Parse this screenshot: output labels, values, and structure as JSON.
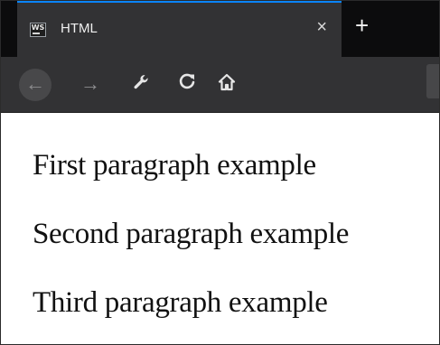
{
  "browser": {
    "tab": {
      "icon_text": "WS",
      "title": "HTML",
      "close_glyph": "×"
    },
    "new_tab_glyph": "+",
    "nav": {
      "back_glyph": "←",
      "forward_glyph": "→",
      "tools_glyph": "🔧",
      "reload_glyph": "C",
      "home_glyph": "⌂"
    },
    "accent_color": "#0a84ff"
  },
  "page": {
    "paragraphs": [
      "First paragraph example",
      "Second paragraph example",
      "Third paragraph example"
    ]
  }
}
